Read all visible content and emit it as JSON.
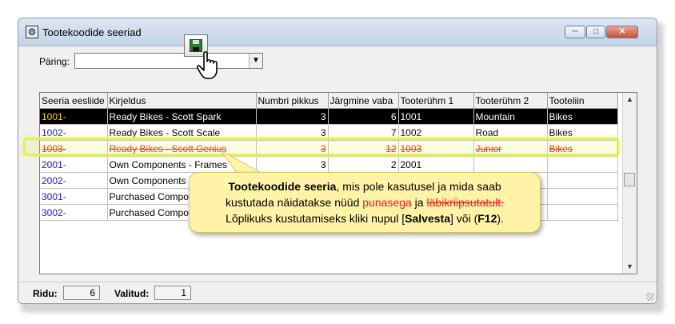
{
  "window": {
    "title": "Tootekoodide seeriad",
    "icon": "app-window-icon",
    "controls": {
      "minimize": "─",
      "maximize": "□",
      "close": "✕"
    }
  },
  "query": {
    "label": "Päring:",
    "value": "",
    "dropdown_icon": "▼"
  },
  "toolbar": {
    "save_icon": "save-disk-icon",
    "cursor_icon": "hand-pointer-icon"
  },
  "grid": {
    "columns": [
      "Seeria eesliide",
      "Kirjeldus",
      "Numbri pikkus",
      "Järgmine vaba",
      "Tooterühm 1",
      "Tooterühm 2",
      "Tooteliin"
    ],
    "rows": [
      {
        "code": "1001-",
        "desc": "Ready Bikes - Scott Spark",
        "len": "3",
        "next": "6",
        "g1": "1001",
        "g2": "Mountain",
        "line": "Bikes",
        "state": "selected"
      },
      {
        "code": "1002-",
        "desc": "Ready Bikes - Scott Scale",
        "len": "3",
        "next": "7",
        "g1": "1002",
        "g2": "Road",
        "line": "Bikes",
        "state": "normal"
      },
      {
        "code": "1003-",
        "desc": "Ready Bikes - Scott Genius",
        "len": "3",
        "next": "12",
        "g1": "1003",
        "g2": "Junior",
        "line": "Bikes",
        "state": "deleted"
      },
      {
        "code": "2001-",
        "desc": "Own Components - Frames",
        "len": "3",
        "next": "2",
        "g1": "2001",
        "g2": "",
        "line": "",
        "state": "normal"
      },
      {
        "code": "2002-",
        "desc": "Own Components - F",
        "len": "",
        "next": "",
        "g1": "",
        "g2": "",
        "line": "",
        "state": "normal"
      },
      {
        "code": "3001-",
        "desc": "Purchased Compon",
        "len": "",
        "next": "",
        "g1": "",
        "g2": "",
        "line": "",
        "state": "normal"
      },
      {
        "code": "3002-",
        "desc": "Purchased Compon",
        "len": "",
        "next": "",
        "g1": "",
        "g2": "",
        "line": "",
        "state": "normal"
      }
    ]
  },
  "callout": {
    "bold_lead": "Tootekoodide seeria",
    "text1": ", mis pole kasutusel ja mida saab",
    "text2": "kustutada näidatakse nüüd ",
    "red_word": "punasega",
    "text3": " ja ",
    "strike_word": "läbikriipsutatult.",
    "text4": "Lõplikuks kustutamiseks kliki nupul  [",
    "save_word": "Salvesta",
    "text5": "] või (",
    "key": "F12",
    "text6": ")."
  },
  "status": {
    "rows_label": "Ridu:",
    "rows_value": "6",
    "selected_label": "Valitud:",
    "selected_value": "1"
  },
  "colors": {
    "highlight": "#e2f052",
    "callout_bg": "#fff3a8",
    "deleted_text": "#e8201e",
    "selected_code": "#ffd700",
    "code_blue": "#1a1ad2"
  }
}
